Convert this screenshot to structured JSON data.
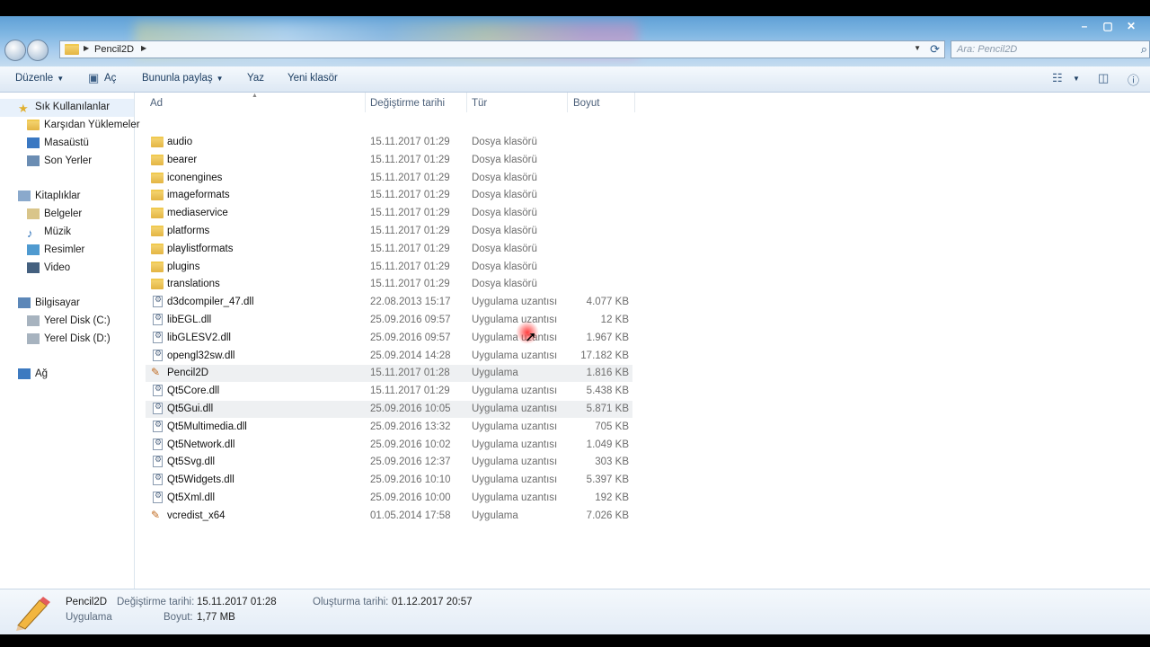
{
  "address": {
    "crumb": "Pencil2D"
  },
  "search": {
    "placeholder": "Ara: Pencil2D"
  },
  "window_controls": [
    "–",
    "▢",
    "✕"
  ],
  "toolbar": {
    "organize": "Düzenle",
    "open": "Aç",
    "share": "Bununla paylaş",
    "print": "Yaz",
    "new_folder": "Yeni klasör"
  },
  "nav": {
    "favorites": "Sık Kullanılanlar",
    "downloads": "Karşıdan Yüklemeler",
    "desktop": "Masaüstü",
    "recent": "Son Yerler",
    "libraries": "Kitaplıklar",
    "documents": "Belgeler",
    "music": "Müzik",
    "pictures": "Resimler",
    "video": "Video",
    "computer": "Bilgisayar",
    "disk_c": "Yerel Disk (C:)",
    "disk_d": "Yerel Disk (D:)",
    "network": "Ağ"
  },
  "columns": {
    "name": "Ad",
    "modified": "Değiştirme tarihi",
    "type": "Tür",
    "size": "Boyut"
  },
  "files": [
    {
      "name": "audio",
      "date": "15.11.2017 01:29",
      "type": "Dosya klasörü",
      "size": "",
      "kind": "folder"
    },
    {
      "name": "bearer",
      "date": "15.11.2017 01:29",
      "type": "Dosya klasörü",
      "size": "",
      "kind": "folder"
    },
    {
      "name": "iconengines",
      "date": "15.11.2017 01:29",
      "type": "Dosya klasörü",
      "size": "",
      "kind": "folder"
    },
    {
      "name": "imageformats",
      "date": "15.11.2017 01:29",
      "type": "Dosya klasörü",
      "size": "",
      "kind": "folder"
    },
    {
      "name": "mediaservice",
      "date": "15.11.2017 01:29",
      "type": "Dosya klasörü",
      "size": "",
      "kind": "folder"
    },
    {
      "name": "platforms",
      "date": "15.11.2017 01:29",
      "type": "Dosya klasörü",
      "size": "",
      "kind": "folder"
    },
    {
      "name": "playlistformats",
      "date": "15.11.2017 01:29",
      "type": "Dosya klasörü",
      "size": "",
      "kind": "folder"
    },
    {
      "name": "plugins",
      "date": "15.11.2017 01:29",
      "type": "Dosya klasörü",
      "size": "",
      "kind": "folder"
    },
    {
      "name": "translations",
      "date": "15.11.2017 01:29",
      "type": "Dosya klasörü",
      "size": "",
      "kind": "folder"
    },
    {
      "name": "d3dcompiler_47.dll",
      "date": "22.08.2013 15:17",
      "type": "Uygulama uzantısı",
      "size": "4.077 KB",
      "kind": "dll"
    },
    {
      "name": "libEGL.dll",
      "date": "25.09.2016 09:57",
      "type": "Uygulama uzantısı",
      "size": "12 KB",
      "kind": "dll"
    },
    {
      "name": "libGLESV2.dll",
      "date": "25.09.2016 09:57",
      "type": "Uygulama uzantısı",
      "size": "1.967 KB",
      "kind": "dll"
    },
    {
      "name": "opengl32sw.dll",
      "date": "25.09.2014 14:28",
      "type": "Uygulama uzantısı",
      "size": "17.182 KB",
      "kind": "dll"
    },
    {
      "name": "Pencil2D",
      "date": "15.11.2017 01:28",
      "type": "Uygulama",
      "size": "1.816 KB",
      "kind": "app",
      "hl": true
    },
    {
      "name": "Qt5Core.dll",
      "date": "15.11.2017 01:29",
      "type": "Uygulama uzantısı",
      "size": "5.438 KB",
      "kind": "dll"
    },
    {
      "name": "Qt5Gui.dll",
      "date": "25.09.2016 10:05",
      "type": "Uygulama uzantısı",
      "size": "5.871 KB",
      "kind": "dll",
      "hl": true
    },
    {
      "name": "Qt5Multimedia.dll",
      "date": "25.09.2016 13:32",
      "type": "Uygulama uzantısı",
      "size": "705 KB",
      "kind": "dll"
    },
    {
      "name": "Qt5Network.dll",
      "date": "25.09.2016 10:02",
      "type": "Uygulama uzantısı",
      "size": "1.049 KB",
      "kind": "dll"
    },
    {
      "name": "Qt5Svg.dll",
      "date": "25.09.2016 12:37",
      "type": "Uygulama uzantısı",
      "size": "303 KB",
      "kind": "dll"
    },
    {
      "name": "Qt5Widgets.dll",
      "date": "25.09.2016 10:10",
      "type": "Uygulama uzantısı",
      "size": "5.397 KB",
      "kind": "dll"
    },
    {
      "name": "Qt5Xml.dll",
      "date": "25.09.2016 10:00",
      "type": "Uygulama uzantısı",
      "size": "192 KB",
      "kind": "dll"
    },
    {
      "name": "vcredist_x64",
      "date": "01.05.2014 17:58",
      "type": "Uygulama",
      "size": "7.026 KB",
      "kind": "setup"
    }
  ],
  "details": {
    "name": "Pencil2D",
    "kind": "Uygulama",
    "modified_label": "Değiştirme tarihi:",
    "modified_value": "15.11.2017 01:28",
    "size_label": "Boyut:",
    "size_value": "1,77 MB",
    "created_label": "Oluşturma tarihi:",
    "created_value": "01.12.2017 20:57"
  }
}
